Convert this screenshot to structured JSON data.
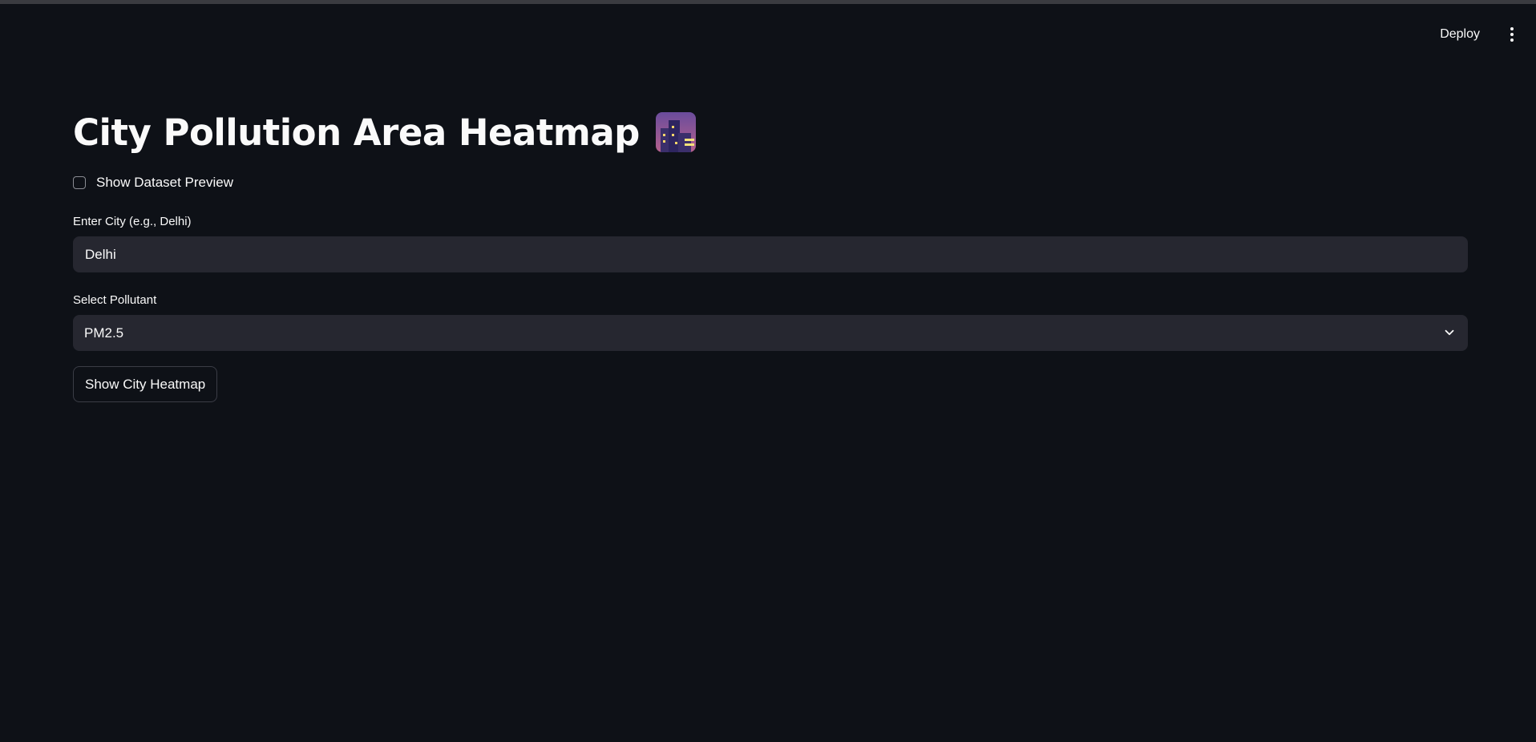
{
  "header": {
    "deploy_label": "Deploy",
    "menu_icon": "more-vertical-icon"
  },
  "main": {
    "title": "City Pollution Area Heatmap",
    "title_emoji": "night-city-emoji",
    "preview_checkbox": {
      "label": "Show Dataset Preview",
      "checked": false
    },
    "city_field": {
      "label": "Enter City (e.g., Delhi)",
      "value": "Delhi"
    },
    "pollutant_select": {
      "label": "Select Pollutant",
      "selected": "PM2.5"
    },
    "submit_label": "Show City Heatmap"
  },
  "colors": {
    "background": "#0e1117",
    "input_background": "#262730",
    "text": "#fafafa"
  }
}
